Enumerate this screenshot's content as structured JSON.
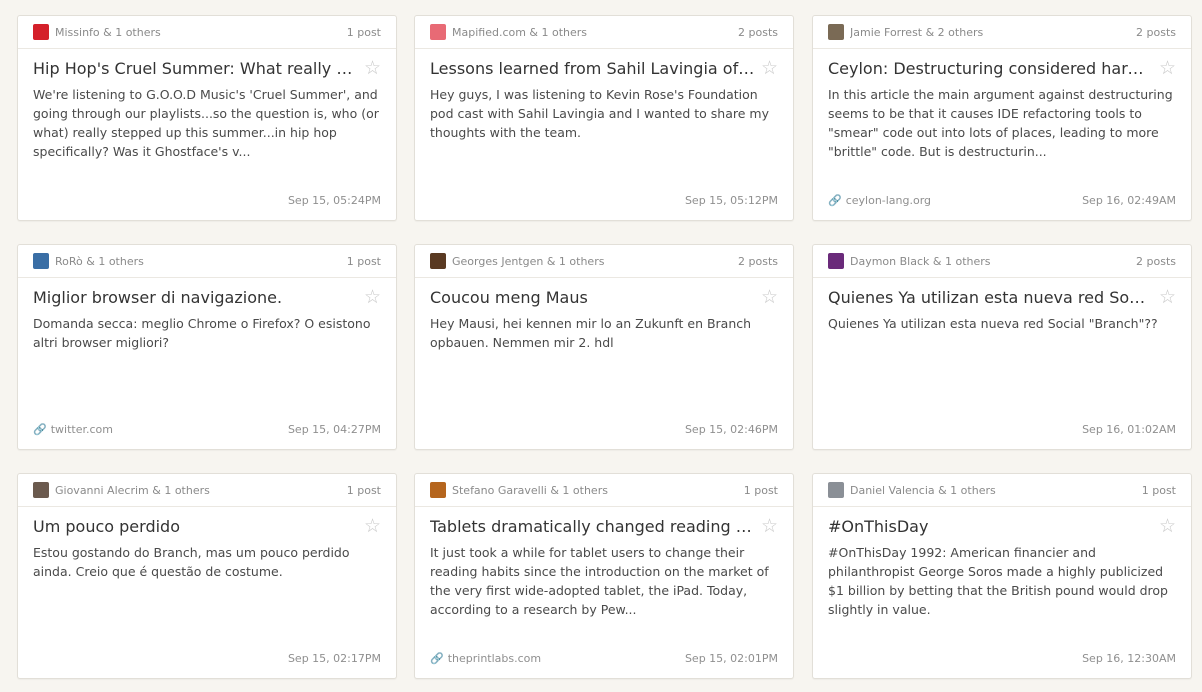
{
  "colors": {
    "background": "#f7f5f0",
    "card_border": "#e2dfd8",
    "star": "#c8c8c8"
  },
  "icons": {
    "star": "star-icon",
    "link": "link-icon"
  },
  "cards": [
    {
      "avatar_color": "#d4202a",
      "participants": "Missinfo & 1 others",
      "posts": "1 post",
      "title": "Hip Hop's Cruel Summer: What really st...",
      "excerpt": "We're listening to G.O.O.D Music's 'Cruel Summer', and going through our playlists...so the question is, who (or what) really stepped up this summer...in hip hop specifically? Was it Ghostface's v...",
      "link": "",
      "date": "Sep 15, 05:24PM"
    },
    {
      "avatar_color": "#e86a75",
      "participants": "Mapified.com & 1 others",
      "posts": "2 posts",
      "title": "Lessons learned from Sahil Lavingia of G...",
      "excerpt": "Hey guys, I was listening to Kevin Rose's Foundation pod cast with Sahil Lavingia and I wanted to share my thoughts with the team.",
      "link": "",
      "date": "Sep 15, 05:12PM"
    },
    {
      "avatar_color": "#7a6a55",
      "participants": "Jamie Forrest & 2 others",
      "posts": "2 posts",
      "title": "Ceylon: Destructuring considered harm...",
      "excerpt": "In this article the main argument against destructuring seems to be that it causes IDE refactoring tools to \"smear\" code out into lots of places, leading to more \"brittle\" code. But is destructurin...",
      "link": "ceylon-lang.org",
      "date": "Sep 16, 02:49AM"
    },
    {
      "avatar_color": "#3a6ea5",
      "participants": "RoRò & 1 others",
      "posts": "1 post",
      "title": "Miglior browser di navigazione.",
      "excerpt": "Domanda secca: meglio Chrome o Firefox? O esistono altri browser migliori?",
      "link": "twitter.com",
      "date": "Sep 15, 04:27PM"
    },
    {
      "avatar_color": "#5a3a22",
      "participants": "Georges Jentgen & 1 others",
      "posts": "2 posts",
      "title": "Coucou meng Maus",
      "excerpt": "Hey Mausi, hei kennen mir lo an Zukunft en Branch opbauen. Nemmen mir 2. hdl",
      "link": "",
      "date": "Sep 15, 02:46PM"
    },
    {
      "avatar_color": "#6a2a7a",
      "participants": "Daymon Black & 1 others",
      "posts": "2 posts",
      "title": "Quienes Ya utilizan esta nueva red Socia...",
      "excerpt": "Quienes Ya utilizan esta nueva red Social \"Branch\"??",
      "link": "",
      "date": "Sep 16, 01:02AM"
    },
    {
      "avatar_color": "#6b5a4e",
      "participants": "Giovanni Alecrim & 1 others",
      "posts": "1 post",
      "title": "Um pouco perdido",
      "excerpt": "Estou gostando do Branch, mas um pouco perdido ainda. Creio que é questão de costume.",
      "link": "",
      "date": "Sep 15, 02:17PM"
    },
    {
      "avatar_color": "#b5651d",
      "participants": "Stefano Garavelli & 1 others",
      "posts": "1 post",
      "title": "Tablets dramatically changed reading ha...",
      "excerpt": "It just took a while for tablet users to change their reading habits since the introduction on the market of the very first wide-adopted tablet, the iPad. Today, according to a research by Pew...",
      "link": "theprintlabs.com",
      "date": "Sep 15, 02:01PM"
    },
    {
      "avatar_color": "#8a8f96",
      "participants": "Daniel Valencia & 1 others",
      "posts": "1 post",
      "title": "#OnThisDay",
      "excerpt": "#OnThisDay 1992: American financier and philanthropist George Soros made a highly publicized $1 billion by betting that the British pound would drop slightly in value.",
      "link": "",
      "date": "Sep 16, 12:30AM"
    }
  ]
}
